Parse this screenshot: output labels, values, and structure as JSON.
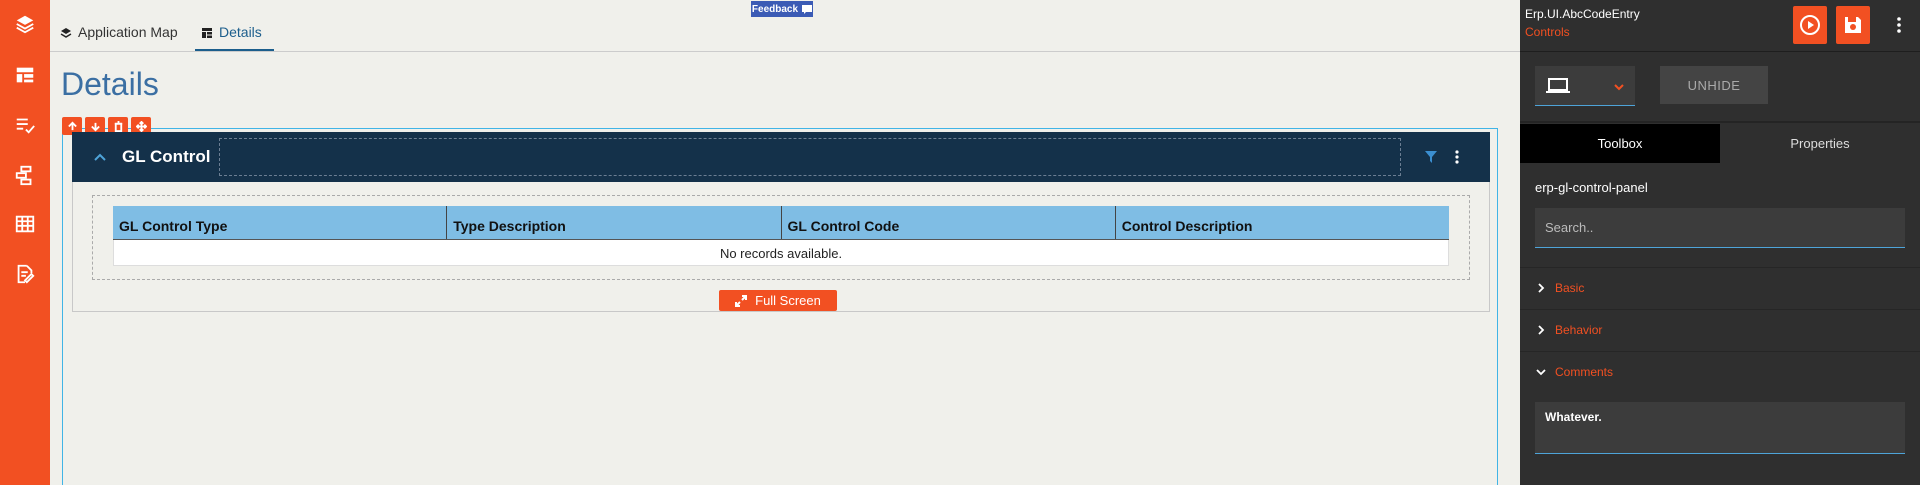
{
  "tabs": [
    {
      "label": "Application Map",
      "icon": "layers-icon"
    },
    {
      "label": "Details",
      "icon": "table-icon",
      "active": true
    }
  ],
  "feedback": {
    "label": "Feedback"
  },
  "page": {
    "title": "Details"
  },
  "panel": {
    "title": "GL Control",
    "grid": {
      "columns": [
        "GL Control Type",
        "Type Description",
        "GL Control Code",
        "Control Description"
      ],
      "empty_text": "No records available."
    },
    "fullscreen_label": "Full Screen"
  },
  "sidebar": {
    "project_name": "Erp.UI.AbcCodeEntry",
    "project_sub": "Controls",
    "unhide_label": "UNHIDE",
    "tabs": {
      "toolbox": "Toolbox",
      "properties": "Properties"
    },
    "element_name": "erp-gl-control-panel",
    "search_placeholder": "Search..",
    "sections": {
      "basic": "Basic",
      "behavior": "Behavior",
      "comments": "Comments"
    },
    "comments_value": "Whatever."
  },
  "colors": {
    "accent": "#f25022",
    "header": "#14314a",
    "grid_header": "#7fbde4",
    "link": "#1c5e8c"
  }
}
